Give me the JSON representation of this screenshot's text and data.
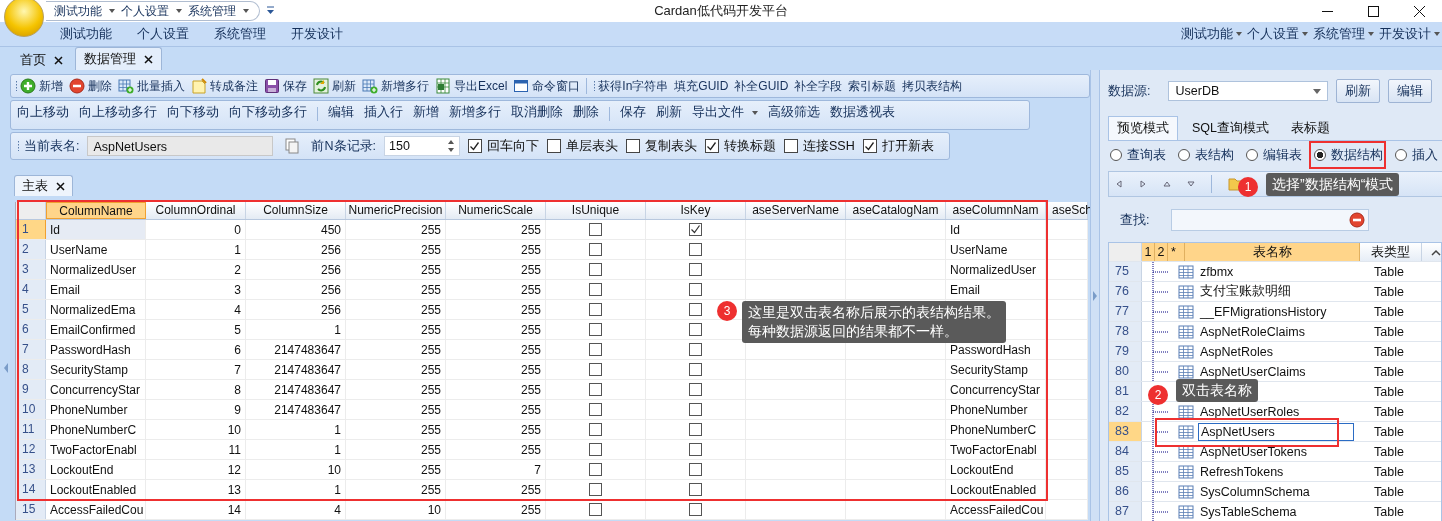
{
  "window": {
    "title": "Cardan低代码开发平台"
  },
  "quick_access": [
    "测试功能",
    "个人设置",
    "系统管理"
  ],
  "menu_left": [
    "测试功能",
    "个人设置",
    "系统管理",
    "开发设计"
  ],
  "menu_right": [
    "测试功能",
    "个人设置",
    "系统管理",
    "开发设计"
  ],
  "document_tabs": [
    {
      "label": "首页",
      "selected": false
    },
    {
      "label": "数据管理",
      "selected": true
    }
  ],
  "main_toolbar": [
    [
      {
        "label": "新增",
        "kind": "add"
      },
      {
        "label": "删除",
        "kind": "remove"
      },
      {
        "label": "批量插入",
        "kind": "batch"
      },
      {
        "label": "转成备注",
        "kind": "note"
      },
      {
        "label": "保存",
        "kind": "save"
      },
      {
        "label": "刷新",
        "kind": "refresh"
      },
      {
        "label": "新增多行",
        "kind": "batch"
      },
      {
        "label": "导出Excel",
        "kind": "excel"
      },
      {
        "label": "命令窗口",
        "kind": "window"
      }
    ],
    [
      {
        "label": "获得In字符串"
      },
      {
        "label": "填充GUID"
      },
      {
        "label": "补全GUID"
      },
      {
        "label": "补全字段"
      },
      {
        "label": "索引标题"
      },
      {
        "label": "拷贝表结构"
      }
    ]
  ],
  "edit_toolbar": [
    [
      {
        "label": "向上移动"
      },
      {
        "label": "向上移动多行"
      },
      {
        "label": "向下移动"
      },
      {
        "label": "向下移动多行"
      }
    ],
    [
      {
        "label": "编辑"
      },
      {
        "label": "插入行"
      },
      {
        "label": "新增"
      },
      {
        "label": "新增多行"
      },
      {
        "label": "取消删除"
      },
      {
        "label": "删除"
      }
    ],
    [
      {
        "label": "保存"
      },
      {
        "label": "刷新"
      },
      {
        "label": "导出文件",
        "dropdown": true
      },
      {
        "label": "高级筛选"
      },
      {
        "label": "数据透视表"
      }
    ]
  ],
  "table_bar": {
    "table_name_label": "当前表名:",
    "table_name": "AspNetUsers",
    "record_label": "前N条记录:",
    "record_count": "150",
    "options": [
      {
        "label": "回车向下",
        "checked": true
      },
      {
        "label": "单层表头",
        "checked": false
      },
      {
        "label": "复制表头",
        "checked": false
      },
      {
        "label": "转换标题",
        "checked": true
      },
      {
        "label": "连接SSH",
        "checked": false
      },
      {
        "label": "打开新表",
        "checked": true
      }
    ]
  },
  "sheet_tabs": [
    {
      "label": "主表",
      "selected": true
    }
  ],
  "grid": {
    "columns": [
      {
        "title": "ColumnName",
        "kind": "text",
        "selected": true
      },
      {
        "title": "ColumnOrdinal",
        "kind": "number",
        "selected": false
      },
      {
        "title": "ColumnSize",
        "kind": "number",
        "selected": false
      },
      {
        "title": "NumericPrecision",
        "kind": "number",
        "selected": false
      },
      {
        "title": "NumericScale",
        "kind": "number",
        "selected": false
      },
      {
        "title": "IsUnique",
        "kind": "check",
        "selected": false
      },
      {
        "title": "IsKey",
        "kind": "check",
        "selected": false
      },
      {
        "title": "aseServerName",
        "kind": "text",
        "selected": false
      },
      {
        "title": "aseCatalogNam",
        "kind": "text",
        "selected": false
      },
      {
        "title": "aseColumnNam",
        "kind": "text",
        "selected": false
      },
      {
        "title": "aseSch",
        "kind": "narrow",
        "selected": false
      }
    ],
    "rows": [
      {
        "number": "1",
        "selected": true,
        "cells": [
          "Id",
          "0",
          "450",
          "255",
          "255",
          false,
          true,
          null,
          null,
          "Id",
          null
        ]
      },
      {
        "number": "2",
        "selected": false,
        "cells": [
          "UserName",
          "1",
          "256",
          "255",
          "255",
          false,
          false,
          null,
          null,
          "UserName",
          null
        ]
      },
      {
        "number": "3",
        "selected": false,
        "cells": [
          "NormalizedUser",
          "2",
          "256",
          "255",
          "255",
          false,
          false,
          null,
          null,
          "NormalizedUser",
          null
        ]
      },
      {
        "number": "4",
        "selected": false,
        "cells": [
          "Email",
          "3",
          "256",
          "255",
          "255",
          false,
          false,
          null,
          null,
          "Email",
          null
        ]
      },
      {
        "number": "5",
        "selected": false,
        "cells": [
          "NormalizedEma",
          "4",
          "256",
          "255",
          "255",
          false,
          false,
          null,
          null,
          null,
          null
        ]
      },
      {
        "number": "6",
        "selected": false,
        "cells": [
          "EmailConfirmed",
          "5",
          "1",
          "255",
          "255",
          false,
          false,
          null,
          null,
          null,
          null
        ]
      },
      {
        "number": "7",
        "selected": false,
        "cells": [
          "PasswordHash",
          "6",
          "2147483647",
          "255",
          "255",
          false,
          false,
          null,
          null,
          "PasswordHash",
          null
        ]
      },
      {
        "number": "8",
        "selected": false,
        "cells": [
          "SecurityStamp",
          "7",
          "2147483647",
          "255",
          "255",
          false,
          false,
          null,
          null,
          "SecurityStamp",
          null
        ]
      },
      {
        "number": "9",
        "selected": false,
        "cells": [
          "ConcurrencyStar",
          "8",
          "2147483647",
          "255",
          "255",
          false,
          false,
          null,
          null,
          "ConcurrencyStar",
          null
        ]
      },
      {
        "number": "10",
        "selected": false,
        "cells": [
          "PhoneNumber",
          "9",
          "2147483647",
          "255",
          "255",
          false,
          false,
          null,
          null,
          "PhoneNumber",
          null
        ]
      },
      {
        "number": "11",
        "selected": false,
        "cells": [
          "PhoneNumberC",
          "10",
          "1",
          "255",
          "255",
          false,
          false,
          null,
          null,
          "PhoneNumberC",
          null
        ]
      },
      {
        "number": "12",
        "selected": false,
        "cells": [
          "TwoFactorEnabl",
          "11",
          "1",
          "255",
          "255",
          false,
          false,
          null,
          null,
          "TwoFactorEnabl",
          null
        ]
      },
      {
        "number": "13",
        "selected": false,
        "cells": [
          "LockoutEnd",
          "12",
          "10",
          "255",
          "7",
          false,
          false,
          null,
          null,
          "LockoutEnd",
          null
        ]
      },
      {
        "number": "14",
        "selected": false,
        "cells": [
          "LockoutEnabled",
          "13",
          "1",
          "255",
          "255",
          false,
          false,
          null,
          null,
          "LockoutEnabled",
          null
        ]
      },
      {
        "number": "15",
        "selected": false,
        "cells": [
          "AccessFailedCou",
          "14",
          "4",
          "10",
          "255",
          false,
          false,
          null,
          null,
          "AccessFailedCou",
          null
        ]
      }
    ]
  },
  "data_source": {
    "label": "数据源:",
    "value": "UserDB",
    "buttons": [
      "刷新",
      "编辑"
    ]
  },
  "mode_tabs": [
    {
      "label": "预览模式",
      "selected": true
    },
    {
      "label": "SQL查询模式",
      "selected": false
    },
    {
      "label": "表标题",
      "selected": false
    }
  ],
  "view_options": [
    {
      "label": "查询表",
      "selected": false
    },
    {
      "label": "表结构",
      "selected": false
    },
    {
      "label": "编辑表",
      "selected": false
    },
    {
      "label": "数据结构",
      "selected": true
    },
    {
      "label": "插入",
      "selected": false
    }
  ],
  "find": {
    "label": "查找:"
  },
  "table_list": {
    "columns": [
      "1",
      "2",
      "*",
      "表名称",
      "表类型"
    ],
    "rows": [
      {
        "number": "75",
        "name": "zfbmx",
        "type": "Table",
        "selected": false
      },
      {
        "number": "76",
        "name": "支付宝账款明细",
        "type": "Table",
        "selected": false
      },
      {
        "number": "77",
        "name": "__EFMigrationsHistory",
        "type": "Table",
        "selected": false
      },
      {
        "number": "78",
        "name": "AspNetRoleClaims",
        "type": "Table",
        "selected": false
      },
      {
        "number": "79",
        "name": "AspNetRoles",
        "type": "Table",
        "selected": false
      },
      {
        "number": "80",
        "name": "AspNetUserClaims",
        "type": "Table",
        "selected": false
      },
      {
        "number": "81",
        "type": "Table",
        "selected": false
      },
      {
        "number": "82",
        "name": "AspNetUserRoles",
        "type": "Table",
        "selected": false
      },
      {
        "number": "83",
        "name": "AspNetUsers",
        "type": "Table",
        "selected": true
      },
      {
        "number": "84",
        "name": "AspNetUserTokens",
        "type": "Table",
        "selected": false
      },
      {
        "number": "85",
        "name": "RefreshTokens",
        "type": "Table",
        "selected": false
      },
      {
        "number": "86",
        "name": "SysColumnSchema",
        "type": "Table",
        "selected": false
      },
      {
        "number": "87",
        "name": "SysTableSchema",
        "type": "Table",
        "selected": false
      }
    ]
  },
  "callouts": [
    {
      "number": "1",
      "lines": [
        "选择”数据结构“模式"
      ]
    },
    {
      "number": "3",
      "lines": [
        "这里是双击表名称后展示的表结构结果。",
        "每种数据源返回的结果都不一样。"
      ]
    },
    {
      "number": "2",
      "lines": [
        "双击表名称"
      ]
    }
  ]
}
